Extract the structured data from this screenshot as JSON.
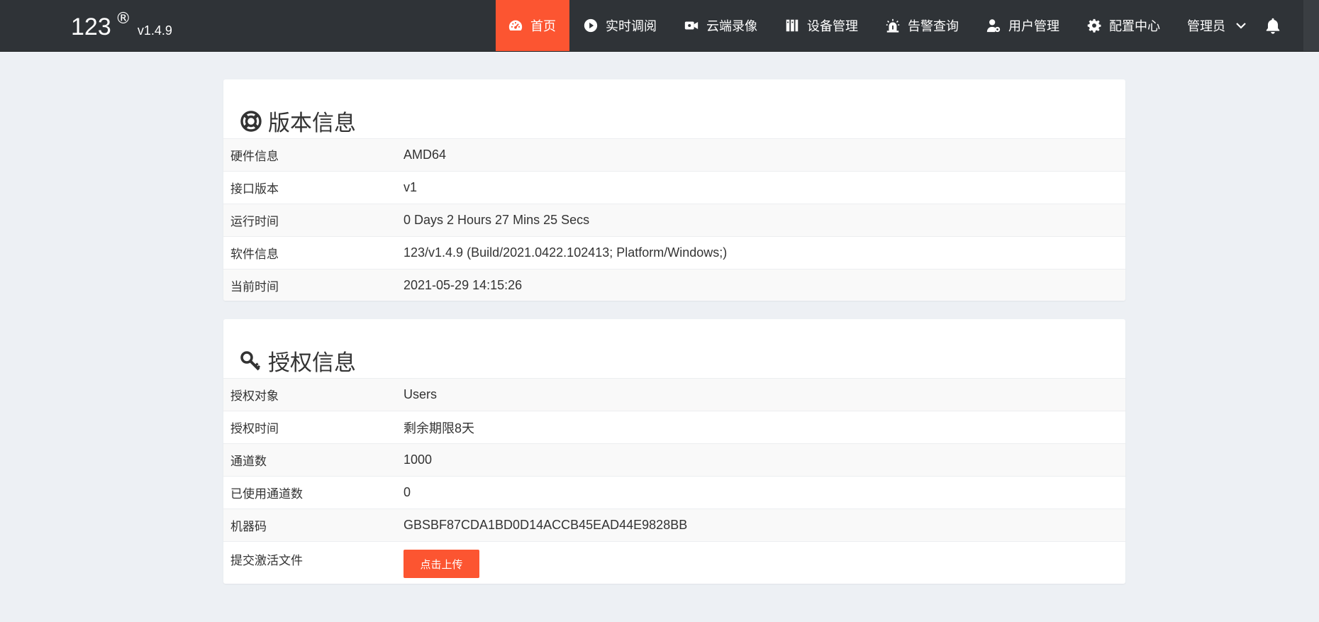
{
  "brand": {
    "name": "123",
    "registered_mark": "®",
    "version": "v1.4.9"
  },
  "colors": {
    "navbar_bg": "#2f3337",
    "accent": "#fc5531",
    "page_bg": "#edf0f4"
  },
  "nav": {
    "items": [
      {
        "label": "首页",
        "icon": "dashboard-icon",
        "active": true
      },
      {
        "label": "实时调阅",
        "icon": "play-circle-icon",
        "active": false
      },
      {
        "label": "云端录像",
        "icon": "video-camera-icon",
        "active": false
      },
      {
        "label": "设备管理",
        "icon": "columns-icon",
        "active": false
      },
      {
        "label": "告警查询",
        "icon": "alarm-icon",
        "active": false
      },
      {
        "label": "用户管理",
        "icon": "user-cog-icon",
        "active": false
      },
      {
        "label": "配置中心",
        "icon": "gear-icon",
        "active": false
      }
    ],
    "user_label": "管理员",
    "user_icon": "chevron-down-icon",
    "bell_icon": "bell-icon"
  },
  "version_info": {
    "title": "版本信息",
    "icon": "lifebuoy-icon",
    "rows": [
      {
        "label": "硬件信息",
        "value": "AMD64"
      },
      {
        "label": "接口版本",
        "value": "v1"
      },
      {
        "label": "运行时间",
        "value": "0 Days 2 Hours 27 Mins 25 Secs"
      },
      {
        "label": "软件信息",
        "value": "123/v1.4.9 (Build/2021.0422.102413; Platform/Windows;)"
      },
      {
        "label": "当前时间",
        "value": "2021-05-29 14:15:26"
      }
    ]
  },
  "license_info": {
    "title": "授权信息",
    "icon": "key-icon",
    "rows": [
      {
        "label": "授权对象",
        "value": "Users"
      },
      {
        "label": "授权时间",
        "value": "剩余期限8天"
      },
      {
        "label": "通道数",
        "value": "1000"
      },
      {
        "label": "已使用通道数",
        "value": "0"
      },
      {
        "label": "机器码",
        "value": "GBSBF87CDA1BD0D14ACCB45EAD44E9828BB"
      }
    ],
    "upload_label": "提交激活文件",
    "upload_button": "点击上传"
  }
}
